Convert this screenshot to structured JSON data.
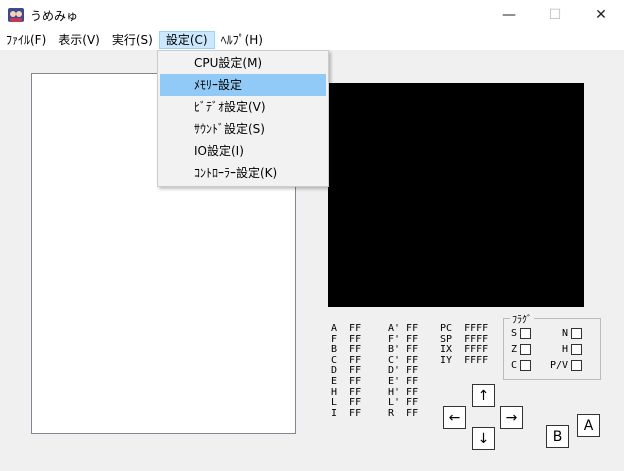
{
  "window": {
    "title": "うめみゅ",
    "minimize": "—",
    "maximize": "☐",
    "close": "✕"
  },
  "menu": {
    "file": "ﾌｧｲﾙ(F)",
    "view": "表示(V)",
    "run": "実行(S)",
    "settings": "設定(C)",
    "help": "ﾍﾙﾌﾟ(H)"
  },
  "settings_menu": {
    "items": [
      "CPU設定(M)",
      "ﾒﾓﾘｰ設定",
      "ﾋﾞﾃﾞｵ設定(V)",
      "ｻｳﾝﾄﾞ設定(S)",
      "IO設定(I)",
      "ｺﾝﾄﾛｰﾗｰ設定(K)"
    ],
    "highlighted_index": 1
  },
  "registers": {
    "main": "A  FF\nF  FF\nB  FF\nC  FF\nD  FF\nE  FF\nH  FF\nL  FF\nI  FF",
    "shadow": "A' FF\nF' FF\nB' FF\nC' FF\nD' FF\nE' FF\nH' FF\nL' FF\nR  FF",
    "wide": "PC  FFFF\nSP  FFFF\nIX  FFFF\nIY  FFFF"
  },
  "flags": {
    "title": "ﾌﾗｸﾞ",
    "s": "S",
    "z": "Z",
    "c": "C",
    "n": "N",
    "h": "H",
    "pv": "P/V"
  },
  "controls": {
    "up": "↑",
    "down": "↓",
    "left": "←",
    "right": "→",
    "a": "A",
    "b": "B"
  }
}
